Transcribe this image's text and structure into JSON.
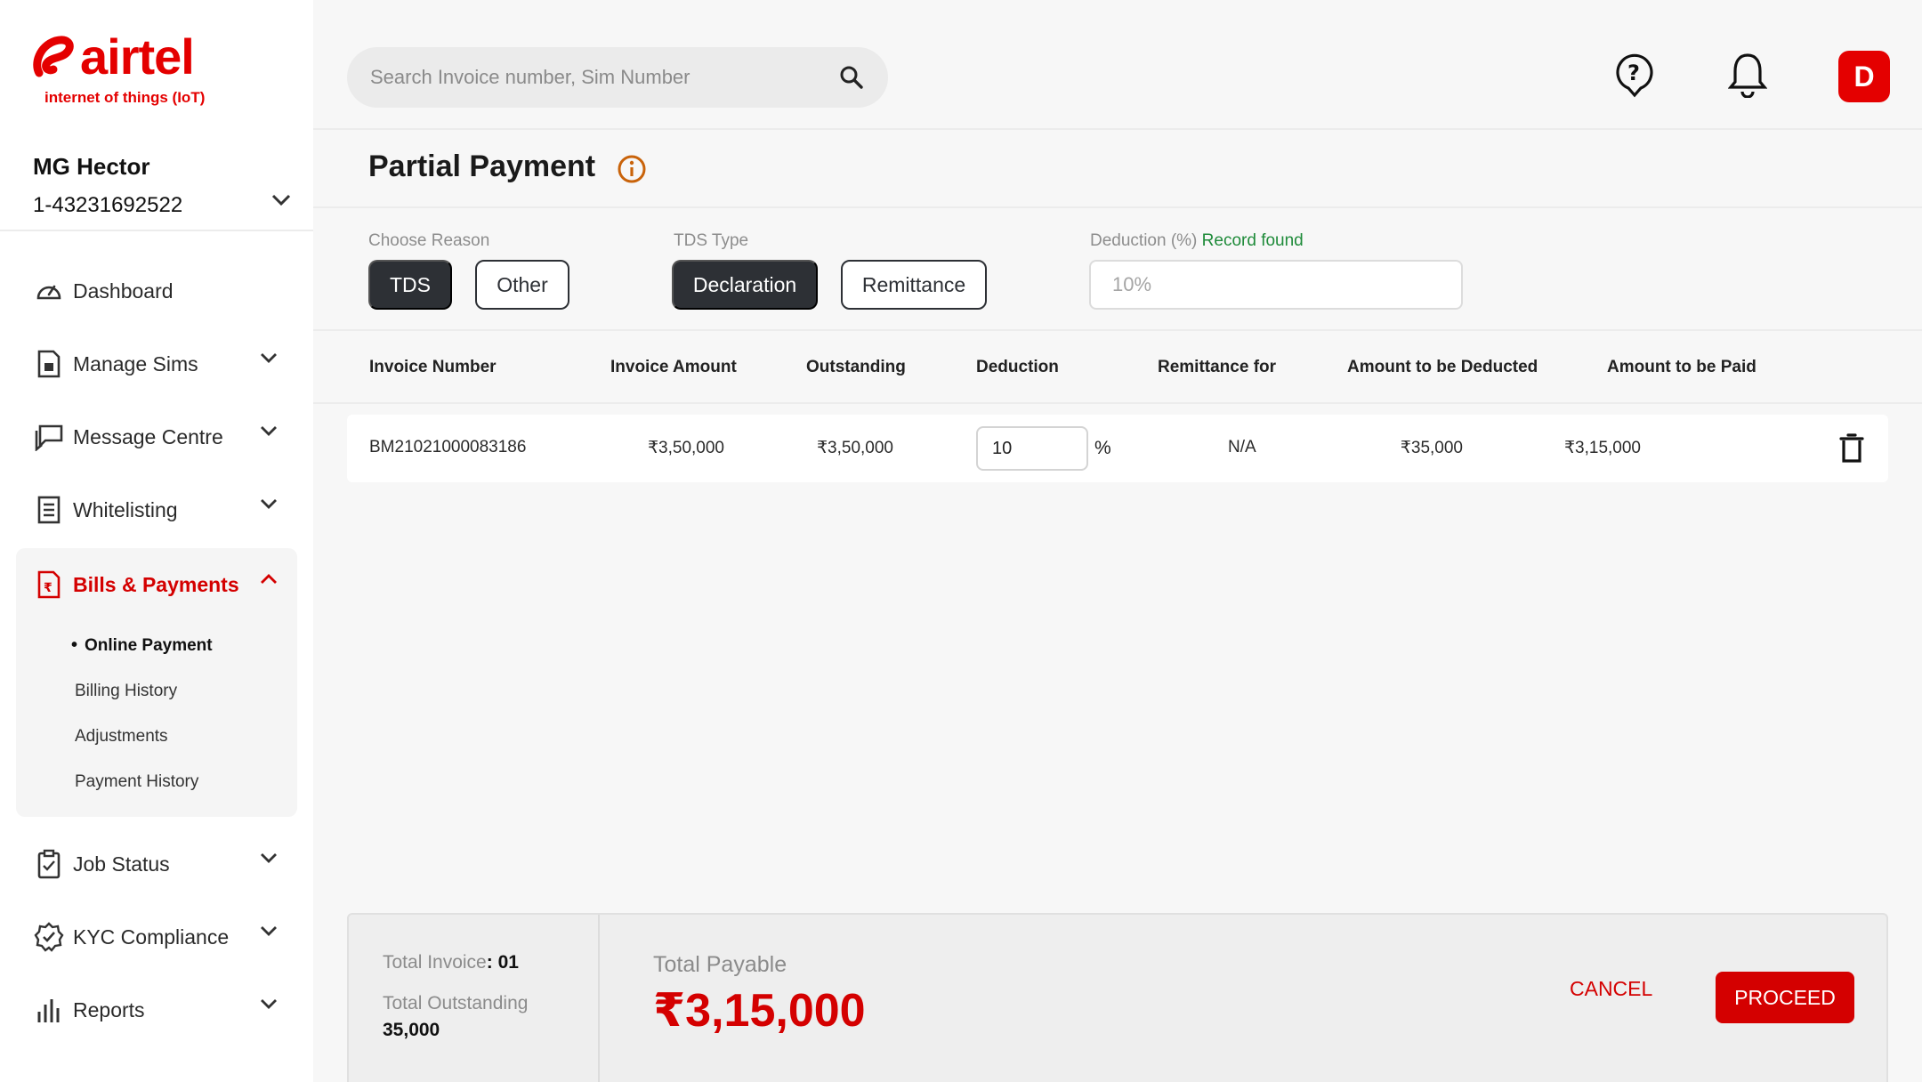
{
  "brand": {
    "name": "airtel",
    "subtitle": "internet of things (IoT)",
    "color": "#e40000"
  },
  "account": {
    "name": "MG Hector",
    "number": "1-43231692522"
  },
  "sidebar": {
    "items": [
      {
        "label": "Dashboard",
        "icon": "dashboard-gauge-icon"
      },
      {
        "label": "Manage Sims",
        "icon": "sim-card-icon"
      },
      {
        "label": "Message Centre",
        "icon": "message-icon"
      },
      {
        "label": "Whitelisting",
        "icon": "list-document-icon"
      },
      {
        "label": "Bills & Payments",
        "icon": "bill-icon",
        "expanded": true,
        "children": [
          "Online Payment",
          "Billing History",
          "Adjustments",
          "Payment History"
        ],
        "active_child": "Online Payment"
      },
      {
        "label": "Job Status",
        "icon": "clipboard-icon"
      },
      {
        "label": "KYC Compliance",
        "icon": "badge-check-icon"
      },
      {
        "label": "Reports",
        "icon": "bar-chart-icon"
      }
    ]
  },
  "search": {
    "placeholder": "Search Invoice number, Sim Number"
  },
  "user": {
    "initial": "D"
  },
  "page": {
    "title": "Partial Payment"
  },
  "filters": {
    "reason_label": "Choose Reason",
    "reasons": [
      "TDS",
      "Other"
    ],
    "reason_selected": "TDS",
    "tds_label": "TDS Type",
    "tds_types": [
      "Declaration",
      "Remittance"
    ],
    "tds_selected": "Declaration",
    "deduction_label": "Deduction (%)",
    "deduction_status": "Record found",
    "deduction_value": "10%"
  },
  "table": {
    "headers": [
      "Invoice Number",
      "Invoice Amount",
      "Outstanding",
      "Deduction",
      "Remittance for",
      "Amount to be Deducted",
      "Amount to be Paid"
    ],
    "rows": [
      {
        "invoice": "BM21021000083186",
        "amount": "₹3,50,000",
        "outstanding": "₹3,50,000",
        "deduction": "10",
        "unit": "%",
        "remittance": "N/A",
        "deducted": "₹35,000",
        "paid": "₹3,15,000"
      }
    ]
  },
  "footer": {
    "total_invoice_label": "Total Invoice",
    "total_invoice": "01",
    "total_outstanding_label": "Total Outstanding",
    "total_outstanding": "35,000",
    "total_payable_label": "Total Payable",
    "total_payable": "₹3,15,000",
    "cancel": "CANCEL",
    "proceed": "PROCEED"
  }
}
